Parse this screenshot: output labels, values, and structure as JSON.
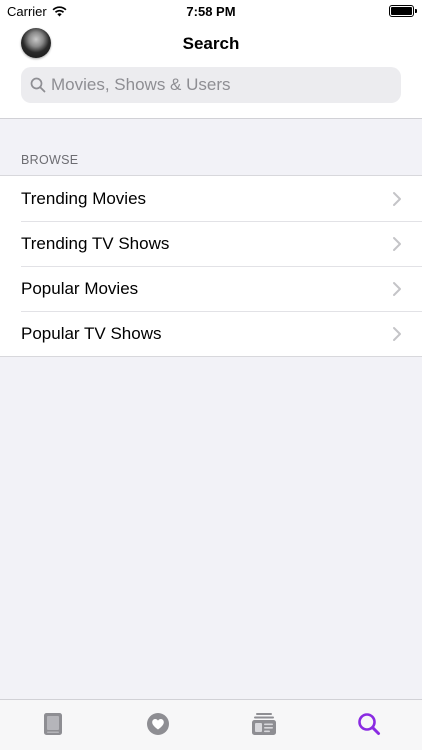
{
  "status_bar": {
    "carrier": "Carrier",
    "time": "7:58 PM",
    "icons": [
      "wifi-icon",
      "battery-icon"
    ]
  },
  "header": {
    "title": "Search",
    "avatar": "user-avatar"
  },
  "search": {
    "placeholder": "Movies, Shows & Users",
    "value": ""
  },
  "browse": {
    "section_title": "BROWSE",
    "items": [
      {
        "label": "Trending Movies"
      },
      {
        "label": "Trending TV Shows"
      },
      {
        "label": "Popular Movies"
      },
      {
        "label": "Popular TV Shows"
      }
    ]
  },
  "tab_bar": {
    "tabs": [
      {
        "icon": "book-icon",
        "active": false
      },
      {
        "icon": "heart-icon",
        "active": false
      },
      {
        "icon": "news-icon",
        "active": false
      },
      {
        "icon": "search-icon",
        "active": true
      }
    ]
  },
  "colors": {
    "accent": "#8a2be2",
    "inactive_icon": "#8e8e93",
    "background": "#f2f2f7"
  }
}
